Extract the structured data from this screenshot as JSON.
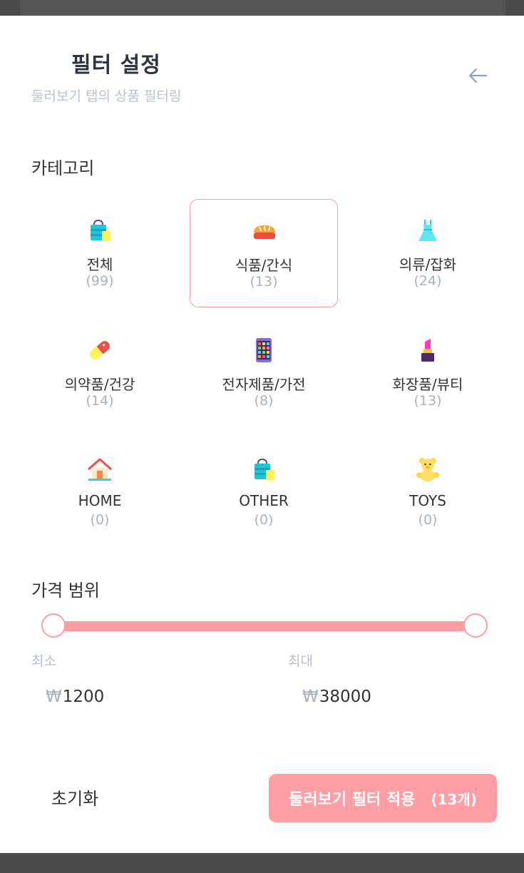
{
  "header": {
    "title": "필터 설정",
    "subtitle": "둘러보기 탭의 상품 필터링",
    "back_icon": "arrow-left-icon"
  },
  "category_section": {
    "label": "카테고리",
    "items": [
      {
        "name": "전체",
        "count": "(99)",
        "icon": "shopping-bag-icon",
        "selected": false
      },
      {
        "name": "식품/간식",
        "count": "(13)",
        "icon": "bread-icon",
        "selected": true
      },
      {
        "name": "의류/잡화",
        "count": "(24)",
        "icon": "dress-icon",
        "selected": false
      },
      {
        "name": "의약품/건강",
        "count": "(14)",
        "icon": "pill-icon",
        "selected": false
      },
      {
        "name": "전자제품/가전",
        "count": "(8)",
        "icon": "phone-icon",
        "selected": false
      },
      {
        "name": "화장품/뷰티",
        "count": "(13)",
        "icon": "lipstick-icon",
        "selected": false
      },
      {
        "name": "HOME",
        "count": "(0)",
        "icon": "house-icon",
        "selected": false
      },
      {
        "name": "OTHER",
        "count": "(0)",
        "icon": "shopping-bag-icon",
        "selected": false
      },
      {
        "name": "TOYS",
        "count": "(0)",
        "icon": "teddy-bear-icon",
        "selected": false
      }
    ]
  },
  "price_section": {
    "label": "가격 범위",
    "min_label": "최소",
    "max_label": "최대",
    "currency": "₩",
    "min_value": "1200",
    "max_value": "38000",
    "slider_min_fraction": 0,
    "slider_max_fraction": 1
  },
  "footer": {
    "reset_label": "초기화",
    "apply_label": "둘러보기 필터 적용",
    "apply_count": "(13개)"
  },
  "colors": {
    "accent": "#ff9ea4",
    "selected_border": "#f5a0a8",
    "muted_text": "#aab2bf"
  }
}
